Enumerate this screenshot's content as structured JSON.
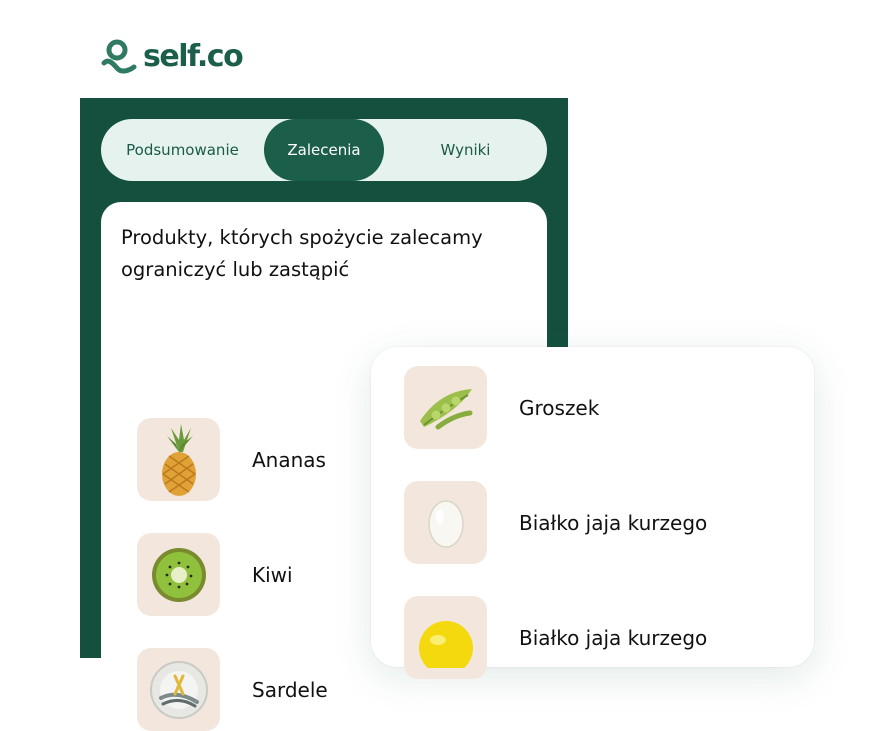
{
  "brand": {
    "name": "self.co",
    "color": "#1b5e4c"
  },
  "tabs": [
    {
      "label": "Podsumowanie",
      "active": false
    },
    {
      "label": "Zalecenia",
      "active": true
    },
    {
      "label": "Wyniki",
      "active": false
    }
  ],
  "card": {
    "title": "Produkty, których spożycie zalecamy ograniczyć lub zastąpić",
    "items": [
      {
        "label": "Ananas",
        "icon": "pineapple-icon"
      },
      {
        "label": "Kiwi",
        "icon": "kiwi-icon"
      },
      {
        "label": "Sardele",
        "icon": "anchovies-icon"
      }
    ]
  },
  "float_card": {
    "items": [
      {
        "label": "Groszek",
        "icon": "pea-pod-icon"
      },
      {
        "label": "Białko jaja kurzego",
        "icon": "egg-white-icon"
      },
      {
        "label": "Białko jaja kurzego",
        "icon": "egg-yolk-icon"
      }
    ]
  },
  "colors": {
    "primary": "#15503f",
    "accent": "#1b5e4a",
    "tabs_bg": "#e6f2ed",
    "thumb_bg": "#f3e7dd"
  }
}
